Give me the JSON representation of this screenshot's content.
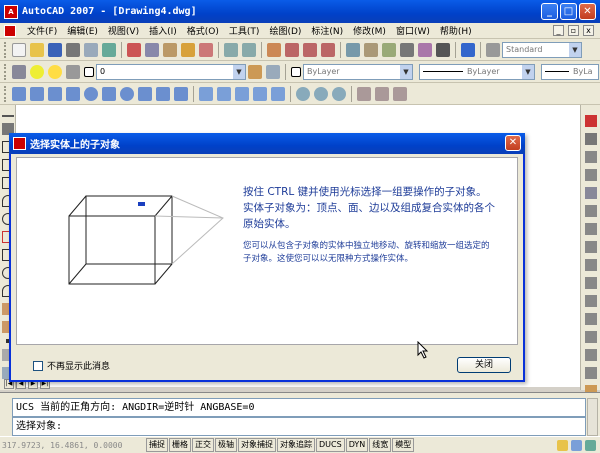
{
  "window": {
    "title": "AutoCAD 2007 - [Drawing4.dwg]",
    "app_icon_text": "A"
  },
  "menu": {
    "items": [
      "文件(F)",
      "编辑(E)",
      "视图(V)",
      "插入(I)",
      "格式(O)",
      "工具(T)",
      "绘图(D)",
      "标注(N)",
      "修改(M)",
      "窗口(W)",
      "帮助(H)"
    ]
  },
  "toolbar": {
    "text_style": "Standard",
    "layer": "0",
    "color": "ByLayer",
    "linetype": "ByLayer",
    "lineweight": "ByLa"
  },
  "tabs": {
    "nav": [
      "|◀",
      "◀",
      "▶",
      "▶|"
    ]
  },
  "dialog": {
    "title": "选择实体上的子对象",
    "text1": "按住 CTRL 键并使用光标选择一组要操作的子对象。实体子对象为：顶点、面、边以及组成复合实体的各个原始实体。",
    "text2": "您可以从包含子对象的实体中独立地移动、旋转和缩放一组选定的子对象。这使您可以以无限种方式操作实体。",
    "checkbox_label": "不再显示此消息",
    "close_label": "关闭"
  },
  "command": {
    "line1": "UCS 当前的正角方向:  ANGDIR=逆时针   ANGBASE=0",
    "line2": "选择对象:"
  },
  "status": {
    "coords": "317.9723, 16.4861, 0.0000",
    "buttons": [
      "捕捉",
      "栅格",
      "正交",
      "极轴",
      "对象捕捉",
      "对象追踪",
      "DUCS",
      "DYN",
      "线宽",
      "模型"
    ]
  },
  "colors": {
    "accent": "#0a5ce8",
    "dialog_text": "#1f3d99",
    "chrome": "#ece9d8"
  }
}
